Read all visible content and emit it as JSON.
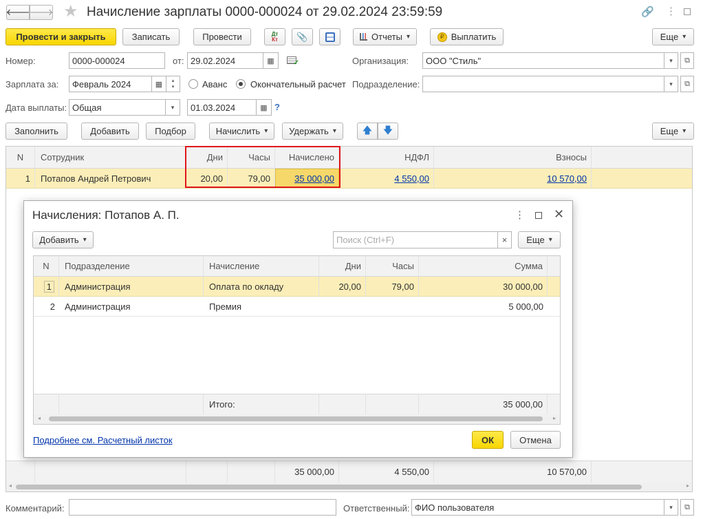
{
  "title": "Начисление зарплаты 0000-000024 от 29.02.2024 23:59:59",
  "toolbar": {
    "post_close": "Провести и закрыть",
    "save": "Записать",
    "post": "Провести",
    "dtkt_top": "Дт",
    "dtkt_bottom": "Кт",
    "reports": "Отчеты",
    "pay": "Выплатить",
    "more": "Еще"
  },
  "fields": {
    "number_label": "Номер:",
    "number": "0000-000024",
    "from_label": "от:",
    "date": "29.02.2024",
    "org_label": "Организация:",
    "org": "ООО \"Стиль\"",
    "salary_label": "Зарплата за:",
    "month": "Февраль 2024",
    "advance": "Аванс",
    "final": "Окончательный расчет",
    "dept_label": "Подразделение:",
    "dept": "",
    "paydate_label": "Дата выплаты:",
    "paytype": "Общая",
    "paydate": "01.03.2024",
    "help": "?"
  },
  "table_toolbar": {
    "fill": "Заполнить",
    "add": "Добавить",
    "select": "Подбор",
    "accrue": "Начислить",
    "withhold": "Удержать",
    "more": "Еще"
  },
  "table": {
    "headers": [
      "N",
      "Сотрудник",
      "Дни",
      "Часы",
      "Начислено",
      "НДФЛ",
      "Взносы"
    ],
    "rows": [
      {
        "n": "1",
        "employee": "Потапов Андрей Петрович",
        "days": "20,00",
        "hours": "79,00",
        "accrued": "35 000,00",
        "ndfl": "4 550,00",
        "contrib": "10 570,00"
      }
    ],
    "totals": {
      "accrued": "35 000,00",
      "ndfl": "4 550,00",
      "contrib": "10 570,00"
    }
  },
  "dialog": {
    "title": "Начисления: Потапов А. П.",
    "add": "Добавить",
    "search_placeholder": "Поиск (Ctrl+F)",
    "clear": "×",
    "more": "Еще",
    "headers": [
      "N",
      "Подразделение",
      "Начисление",
      "Дни",
      "Часы",
      "Сумма"
    ],
    "rows": [
      {
        "n": "1",
        "dept": "Администрация",
        "accrual": "Оплата по окладу",
        "days": "20,00",
        "hours": "79,00",
        "sum": "30 000,00"
      },
      {
        "n": "2",
        "dept": "Администрация",
        "accrual": "Премия",
        "days": "",
        "hours": "",
        "sum": "5 000,00"
      }
    ],
    "total_label": "Итого:",
    "total_sum": "35 000,00",
    "link": "Подробнее см. Расчетный листок",
    "ok": "ОК",
    "cancel": "Отмена"
  },
  "footer": {
    "comment_label": "Комментарий:",
    "comment": "",
    "resp_label": "Ответственный:",
    "resp": "ФИО пользователя"
  },
  "colors": {
    "accent": "#f8d600",
    "selected_row": "#fbeeb8",
    "highlight_box": "#e0161b",
    "link": "#0033aa"
  }
}
